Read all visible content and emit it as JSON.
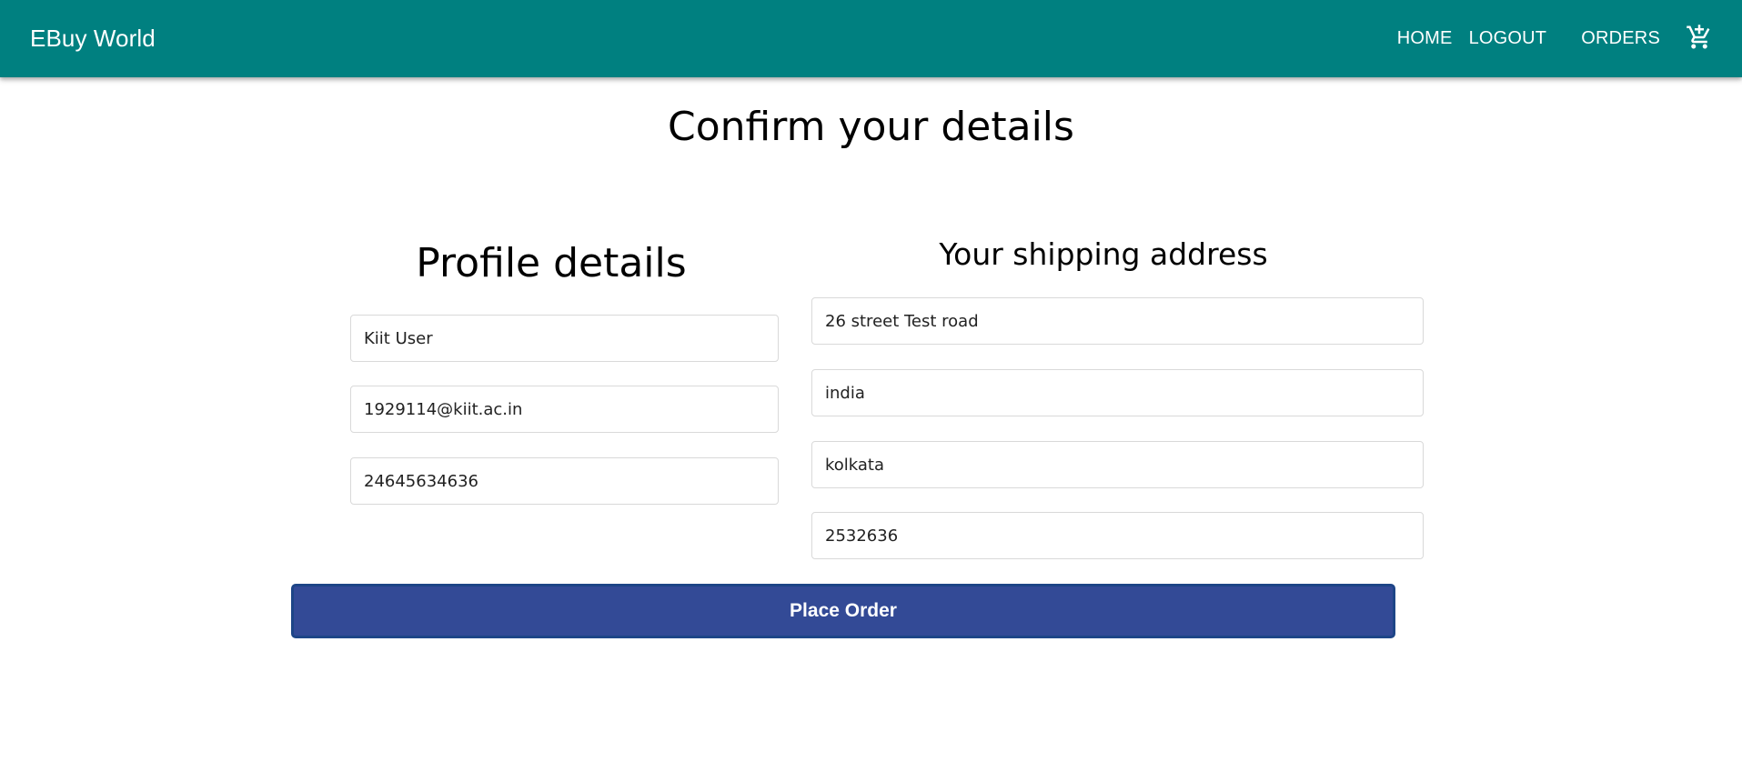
{
  "app_bar": {
    "brand": "EBuy World",
    "nav": {
      "home": "HOME",
      "logout": "LOGOUT",
      "orders": "ORDERS"
    },
    "cart_icon": "add-shopping-cart-icon",
    "background_color": "#008080"
  },
  "page": {
    "title": "Confirm your details"
  },
  "profile": {
    "heading": "Profile details",
    "name": "Kiit User",
    "email": "1929114@kiit.ac.in",
    "phone": "24645634636"
  },
  "shipping": {
    "heading": "Your shipping address",
    "street": "26 street Test road",
    "country": "india",
    "city": "kolkata",
    "pincode": "2532636"
  },
  "actions": {
    "place_order_label": "Place Order",
    "button_color": "#334a96"
  }
}
